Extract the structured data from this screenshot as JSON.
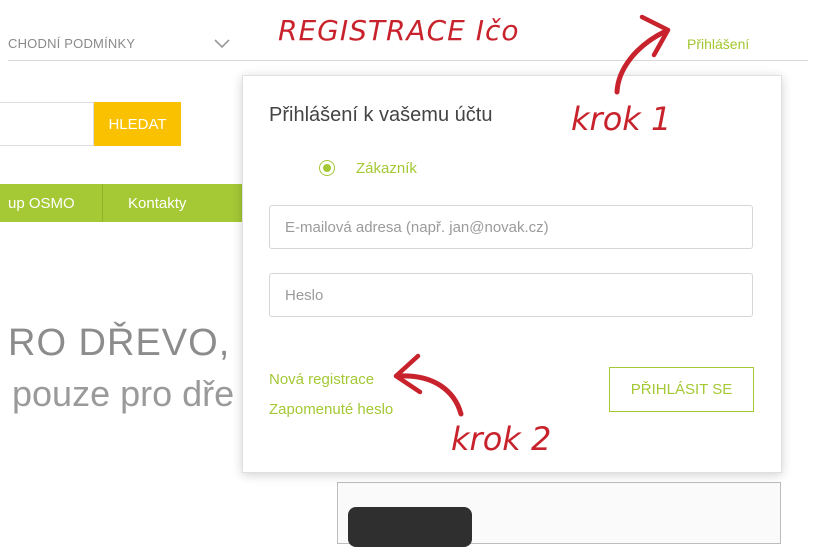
{
  "header": {
    "menu_label": "CHODNÍ PODMÍNKY",
    "login_link": "Přihlášení"
  },
  "search": {
    "button_label": "HLEDAT",
    "placeholder": ""
  },
  "nav": {
    "items": [
      "up OSMO",
      "Kontakty"
    ]
  },
  "hero": {
    "line1": "RO DŘEVO,",
    "line2": "pouze pro dře"
  },
  "annotations": {
    "title": "REGISTRACE Ičo",
    "step1": "krok 1",
    "step2": "krok 2"
  },
  "login_popup": {
    "title": "Přihlášení k vašemu účtu",
    "account_type": "Zákazník",
    "email_placeholder": "E-mailová adresa (např. jan@novak.cz)",
    "password_placeholder": "Heslo",
    "register_link": "Nová registrace",
    "forgot_link": "Zapomenuté heslo",
    "submit_label": "PŘIHLÁSIT SE"
  },
  "colors": {
    "accent": "#a4c935",
    "search_button": "#f9c100",
    "annotation": "#c8232c"
  }
}
